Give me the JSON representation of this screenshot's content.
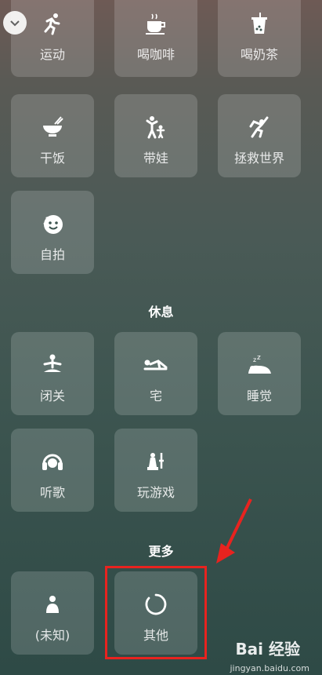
{
  "top_row": [
    {
      "label": "运动",
      "icon": "running-person-icon"
    },
    {
      "label": "喝咖啡",
      "icon": "coffee-cup-icon"
    },
    {
      "label": "喝奶茶",
      "icon": "bubble-tea-icon"
    }
  ],
  "activities": [
    {
      "label": "干饭",
      "icon": "rice-bowl-icon"
    },
    {
      "label": "带娃",
      "icon": "parent-child-icon"
    },
    {
      "label": "拯救世界",
      "icon": "superhero-icon"
    },
    {
      "label": "自拍",
      "icon": "selfie-face-icon"
    }
  ],
  "rest_section": {
    "title": "休息",
    "items": [
      {
        "label": "闭关",
        "icon": "meditation-icon"
      },
      {
        "label": "宅",
        "icon": "lying-down-icon"
      },
      {
        "label": "睡觉",
        "icon": "sleeping-icon"
      },
      {
        "label": "听歌",
        "icon": "headphones-icon"
      },
      {
        "label": "玩游戏",
        "icon": "game-piece-icon"
      }
    ]
  },
  "more_section": {
    "title": "更多",
    "items": [
      {
        "label": "(未知)",
        "icon": "person-icon"
      },
      {
        "label": "其他",
        "icon": "loading-circle-icon"
      }
    ]
  },
  "watermark": {
    "text": "Bai 经验",
    "url": "jingyan.baidu.com"
  },
  "colors": {
    "highlight": "#e8231f",
    "tile_bg": "rgba(255,255,255,0.16)"
  }
}
